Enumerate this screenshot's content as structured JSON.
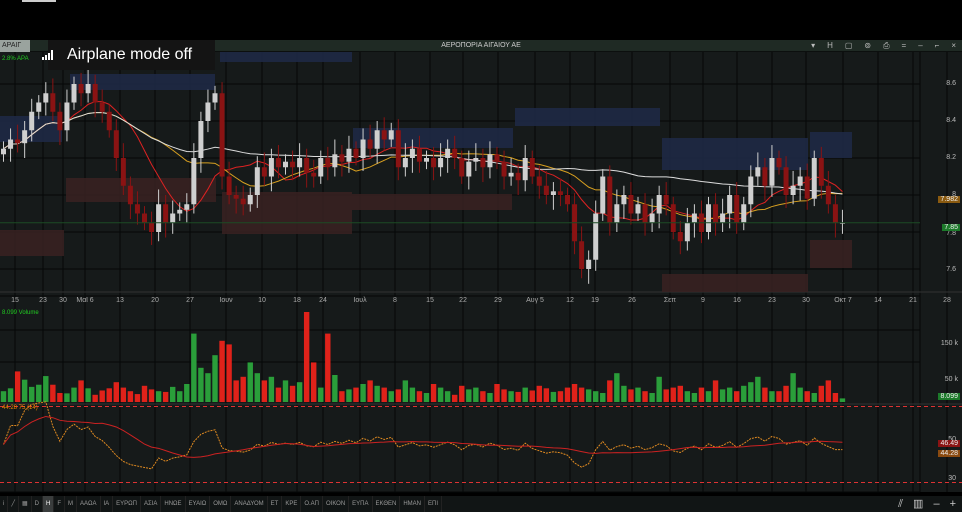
{
  "window": {
    "symbol": "ΑΡΑΙΓ",
    "title": "ΑΕΡΟΠΟΡΙΑ ΑΙΓΑΙΟΥ ΑΕ",
    "controls": [
      "▾",
      "H",
      "▢",
      "⊚",
      "⎙",
      "=",
      "–",
      "⌐",
      "×"
    ]
  },
  "toast": {
    "text": "Airplane mode off"
  },
  "header": {
    "change": "2.8% ΑΡΑ"
  },
  "price_axis": {
    "ticks": [
      "8.6",
      "8.4",
      "8.2",
      "8",
      "7.8",
      "7.6"
    ],
    "ma_tag": "7.982",
    "last_tag": "7.85"
  },
  "volume": {
    "label": "8.099 Volume",
    "ticks": [
      "150 k",
      "50 k"
    ],
    "last_tag": "8.099"
  },
  "rsi": {
    "label": "44.28 75 (14)",
    "ticks": [
      "50",
      "30"
    ],
    "tag1": "46.49",
    "tag2": "44.28"
  },
  "colors": {
    "up": "#2a9e3a",
    "down": "#e0221a",
    "up_candle": "#cfcfcf",
    "down_candle": "#8a1313",
    "ma_fast": "#d22",
    "ma_slow": "#d8a020",
    "ma_long": "#ddd"
  },
  "chart_data": {
    "type": "candlestick",
    "title": "ΑΕΡΟΠΟΡΙΑ ΑΙΓΑΙΟΥ ΑΕ",
    "ylim": [
      7.45,
      8.75
    ],
    "x_labels": [
      "15",
      "23",
      "30",
      "Μαϊ 6",
      "13",
      "20",
      "27",
      "Ιουν",
      "10",
      "18",
      "24",
      "Ιουλ",
      "8",
      "15",
      "22",
      "29",
      "Αυγ 5",
      "12",
      "19",
      "26",
      "Σεπ",
      "9",
      "16",
      "23",
      "30",
      "Οκτ 7",
      "14",
      "21",
      "28"
    ],
    "close": [
      8.25,
      8.3,
      8.28,
      8.35,
      8.45,
      8.5,
      8.55,
      8.45,
      8.35,
      8.5,
      8.6,
      8.55,
      8.6,
      8.5,
      8.45,
      8.35,
      8.2,
      8.05,
      7.95,
      7.9,
      7.85,
      7.8,
      7.95,
      7.85,
      7.9,
      7.92,
      7.95,
      8.2,
      8.4,
      8.5,
      8.55,
      8.1,
      8.0,
      7.98,
      7.95,
      8.0,
      8.15,
      8.1,
      8.2,
      8.15,
      8.18,
      8.15,
      8.2,
      8.12,
      8.1,
      8.2,
      8.15,
      8.22,
      8.18,
      8.25,
      8.2,
      8.3,
      8.25,
      8.35,
      8.3,
      8.35,
      8.15,
      8.2,
      8.25,
      8.18,
      8.2,
      8.15,
      8.2,
      8.25,
      8.2,
      8.1,
      8.18,
      8.2,
      8.15,
      8.22,
      8.18,
      8.1,
      8.12,
      8.08,
      8.2,
      8.1,
      8.05,
      8.0,
      8.02,
      8.0,
      7.95,
      7.75,
      7.6,
      7.65,
      7.9,
      8.1,
      7.85,
      7.95,
      8.0,
      7.9,
      7.95,
      7.85,
      7.9,
      8.0,
      7.95,
      7.8,
      7.75,
      7.85,
      7.9,
      7.8,
      7.95,
      7.85,
      7.9,
      8.0,
      7.85,
      7.95,
      8.1,
      8.15,
      8.05,
      8.2,
      8.15,
      8.0,
      8.05,
      8.1,
      7.98,
      8.2,
      8.05,
      7.95,
      7.85,
      7.85
    ],
    "volume": [
      30,
      38,
      85,
      62,
      42,
      48,
      72,
      48,
      25,
      24,
      40,
      60,
      38,
      20,
      32,
      38,
      55,
      40,
      30,
      22,
      45,
      35,
      30,
      28,
      42,
      30,
      50,
      190,
      95,
      80,
      130,
      170,
      160,
      60,
      70,
      110,
      80,
      60,
      70,
      40,
      60,
      45,
      55,
      250,
      110,
      40,
      190,
      75,
      30,
      35,
      40,
      50,
      60,
      45,
      40,
      30,
      35,
      60,
      40,
      30,
      25,
      50,
      40,
      30,
      20,
      45,
      35,
      40,
      30,
      25,
      50,
      35,
      30,
      28,
      40,
      32,
      45,
      38,
      28,
      30,
      40,
      50,
      40,
      35,
      30,
      25,
      60,
      80,
      45,
      35,
      40,
      30,
      25,
      70,
      35,
      40,
      45,
      30,
      25,
      40,
      30,
      60,
      35,
      40,
      30,
      45,
      55,
      70,
      40,
      30,
      30,
      45,
      80,
      40,
      30,
      25,
      45,
      60,
      25,
      10
    ]
  },
  "toolbar": {
    "tools": [
      "i",
      "╱",
      "▦"
    ],
    "periods": [
      "D",
      "H",
      "F",
      "M",
      "ΑΑΩΑ",
      "ΙΑ",
      "ΕΥΡΩΠ",
      "ΑΣΙΑ",
      "ΗΝΩΕ",
      "ΕΥΑΙΩ",
      "ΟΜΩ",
      "ΑΝΑΔΥΟΜ",
      "ΕΤ",
      "ΚΡΕ",
      "Ο.ΑΠ",
      "ΟΙΚΟΝ",
      "ΕΥΠΑ",
      "ΕΚΘΕΝ",
      "ΗΜΑΝ",
      "ΕΠΙ"
    ],
    "right": [
      "⫽",
      "▥",
      "–",
      "+"
    ]
  }
}
